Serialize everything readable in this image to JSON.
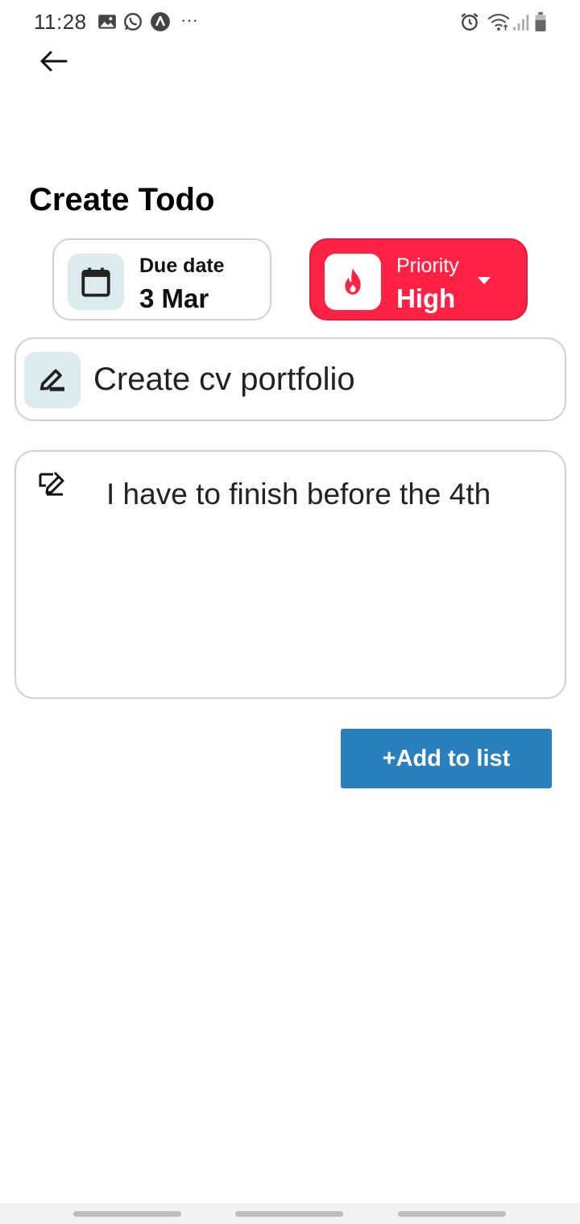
{
  "status_bar": {
    "time": "11:28",
    "left_icons": [
      "gallery-icon",
      "whatsapp-icon",
      "app-icon",
      "more-dots-icon"
    ],
    "more": "···",
    "right_icons": [
      "alarm-icon",
      "wifi-icon",
      "signal-icon",
      "battery-icon"
    ]
  },
  "header": {
    "back_icon": "arrow-left-icon"
  },
  "page": {
    "title": "Create Todo"
  },
  "due_date": {
    "label": "Due date",
    "value": "3 Mar",
    "icon": "calendar-icon"
  },
  "priority": {
    "label": "Priority",
    "value": "High",
    "icon": "flame-icon",
    "color": "#ff2244"
  },
  "title_field": {
    "value": "Create cv portfolio",
    "icon": "edit-pencil-icon"
  },
  "description_field": {
    "value": "I have to finish before the 4th",
    "icon": "note-edit-icon"
  },
  "actions": {
    "add_label": "+Add to list",
    "add_color": "#2a7fbd"
  },
  "colors": {
    "chip_icon_bg": "#dcebee",
    "border": "#cfd3d6"
  }
}
